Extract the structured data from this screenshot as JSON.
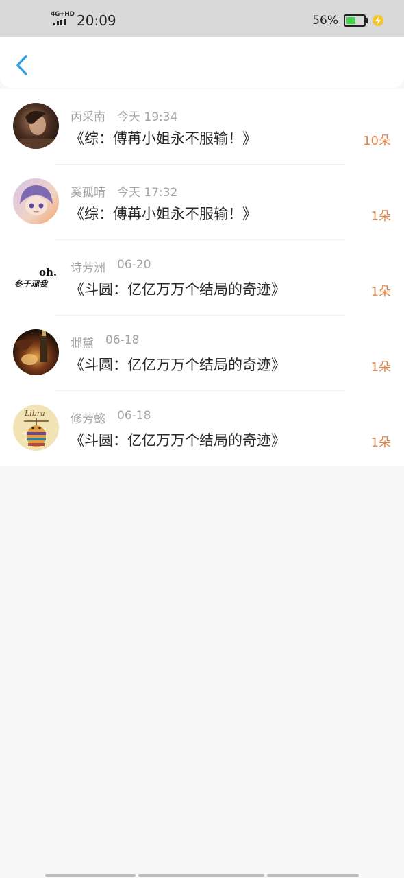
{
  "status_bar": {
    "network": "4G+HD",
    "time": "20:09",
    "battery_percent": "56%",
    "battery_level": 0.56,
    "charging": true,
    "colors": {
      "background": "#d9d9d9",
      "battery": "#44d34b",
      "charge": "#f6c42a"
    }
  },
  "nav": {
    "back_icon": "chevron-left-icon",
    "accent_color": "#2fa0e6"
  },
  "gifts": [
    {
      "sender": "丙采南",
      "time": "今天 19:34",
      "book": "《综：傅苒小姐永不服输！》",
      "amount": "10朵",
      "avatar": "avatar-photo-1"
    },
    {
      "sender": "奚孤晴",
      "time": "今天 17:32",
      "book": "《综：傅苒小姐永不服输！》",
      "amount": "1朵",
      "avatar": "avatar-anime-girl"
    },
    {
      "sender": "诗芳洲",
      "time": "06-20",
      "book": "《斗圆：亿亿万万个结局的奇迹》",
      "amount": "1朵",
      "avatar": "avatar-text-oh"
    },
    {
      "sender": "邶黛",
      "time": "06-18",
      "book": "《斗圆：亿亿万万个结局的奇迹》",
      "amount": "1朵",
      "avatar": "avatar-photo-2"
    },
    {
      "sender": "修芳懿",
      "time": "06-18",
      "book": "《斗圆：亿亿万万个结局的奇迹》",
      "amount": "1朵",
      "avatar": "avatar-libra"
    }
  ],
  "avatar_texts": {
    "oh": "oh.",
    "handwriting": "冬于现我",
    "libra": "Libra"
  },
  "colors": {
    "amount": "#e0874a",
    "meta": "#a4a4a4",
    "title": "#2a2a2a"
  }
}
